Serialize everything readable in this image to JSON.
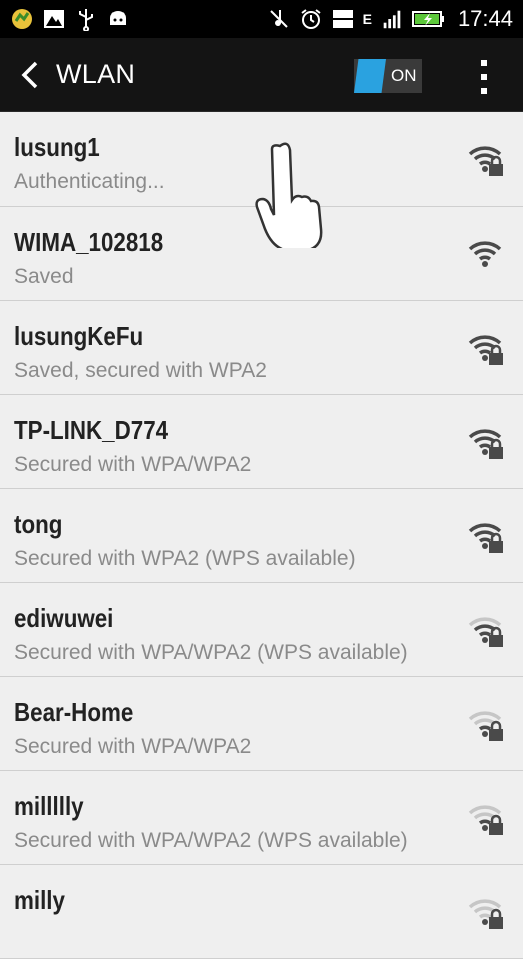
{
  "status_bar": {
    "network_type": "E",
    "time": "17:44",
    "icons": [
      "app-icon",
      "image-icon",
      "usb-icon",
      "android-debug-icon",
      "mute-icon",
      "alarm-icon",
      "3g-1x-icon",
      "signal-icon",
      "battery-charging-icon"
    ]
  },
  "action_bar": {
    "title": "WLAN",
    "toggle_label": "ON",
    "toggle_color": "#2aa2e0"
  },
  "networks": [
    {
      "ssid": "lusung1",
      "status": "Authenticating...",
      "secured": true,
      "signal": 4
    },
    {
      "ssid": "WIMA_102818",
      "status": "Saved",
      "secured": false,
      "signal": 4
    },
    {
      "ssid": "lusungKeFu",
      "status": "Saved, secured with WPA2",
      "secured": true,
      "signal": 4
    },
    {
      "ssid": "TP-LINK_D774",
      "status": "Secured with WPA/WPA2",
      "secured": true,
      "signal": 4
    },
    {
      "ssid": "tong",
      "status": "Secured with WPA2 (WPS available)",
      "secured": true,
      "signal": 4
    },
    {
      "ssid": "ediwuwei",
      "status": "Secured with WPA/WPA2 (WPS available)",
      "secured": true,
      "signal": 3
    },
    {
      "ssid": "Bear-Home",
      "status": "Secured with WPA/WPA2",
      "secured": true,
      "signal": 2
    },
    {
      "ssid": "millllly",
      "status": "Secured with WPA/WPA2 (WPS available)",
      "secured": true,
      "signal": 2
    },
    {
      "ssid": "milly",
      "status": "",
      "secured": true,
      "signal": 1
    }
  ]
}
